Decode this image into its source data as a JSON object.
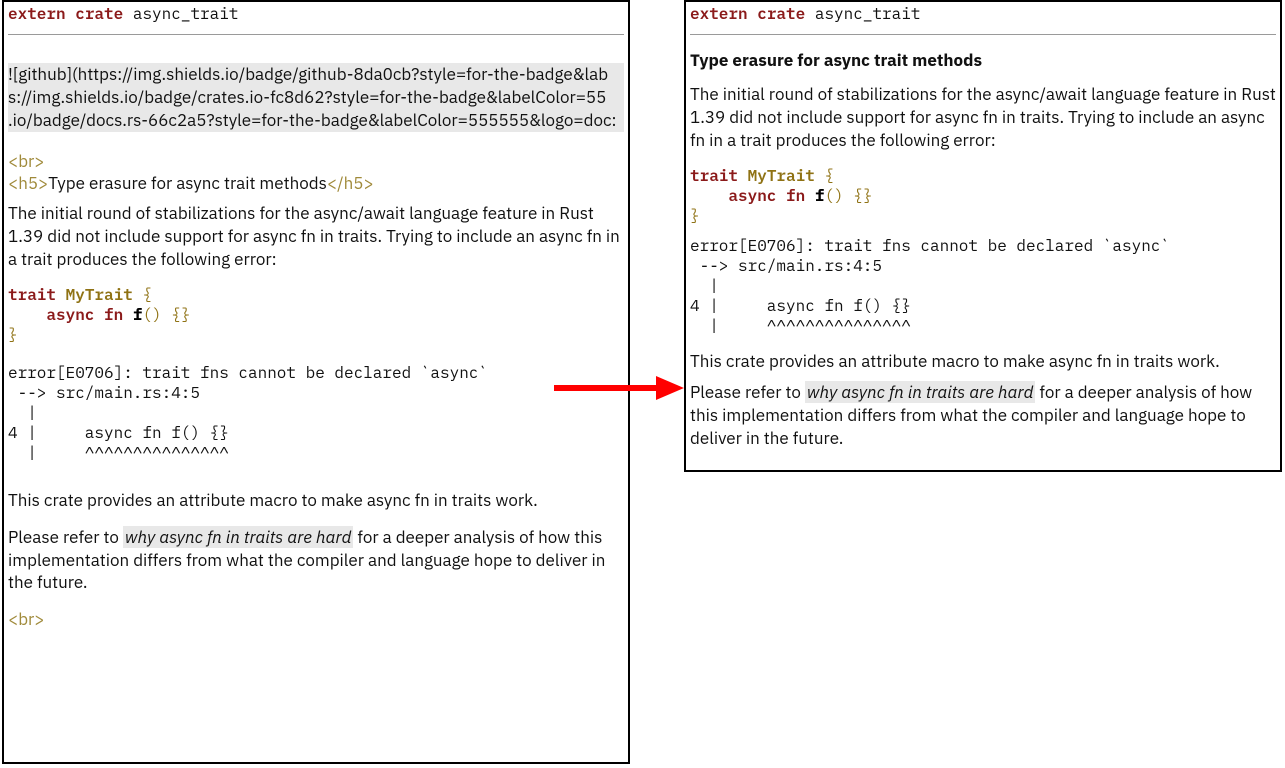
{
  "header_code": {
    "kw1": "extern",
    "kw2": "crate",
    "ident": "async_trait"
  },
  "badges_lines": [
    "![github](https://img.shields.io/badge/github-8da0cb?style=for-the-badge&lab",
    "s://img.shields.io/badge/crates.io-fc8d62?style=for-the-badge&labelColor=55",
    ".io/badge/docs.rs-66c2a5?style=for-the-badge&labelColor=555555&logo=doc:"
  ],
  "tags": {
    "br": "<br>",
    "h5_open": "<h5>",
    "h5_close": "</h5>"
  },
  "h5_text": "Type erasure for async trait methods",
  "para1": "The initial round of stabilizations for the async/await language feature in Rust 1.39 did not include support for async fn in traits. Trying to include an async fn in a trait produces the following error:",
  "trait_code": {
    "l1_kw": "trait",
    "l1_ident": "MyTrait",
    "l1_brace": "{",
    "l2_kw": "async",
    "l2_kw2": "fn",
    "l2_name": "f",
    "l2_parens": "()",
    "l2_body": "{}",
    "l3": "}"
  },
  "error_block": "error[E0706]: trait fns cannot be declared `async`\n --> src/main.rs:4:5\n  |\n4 |     async fn f() {}\n  |     ^^^^^^^^^^^^^^^",
  "para2": "This crate provides an attribute macro to make async fn in traits work.",
  "para3_pre": "Please refer to ",
  "para3_link": "why async fn in traits are hard",
  "para3_post": " for a deeper analysis of how this implementation differs from what the compiler and language hope to deliver in the future."
}
